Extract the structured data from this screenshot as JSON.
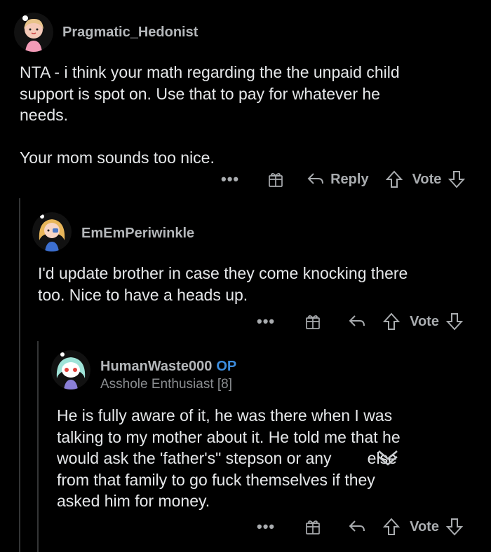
{
  "comments": [
    {
      "username": "Pragmatic_Hedonist",
      "body": "NTA - i think your math regarding the the unpaid child\nsupport is spot on. Use that to pay for whatever he\nneeds.\n\nYour mom sounds too nice.",
      "actions": {
        "more": "•••",
        "reply": "Reply",
        "vote": "Vote"
      }
    },
    {
      "username": "EmEmPeriwinkle",
      "body": "I'd update brother in case they come knocking there\ntoo. Nice to have a heads up.",
      "actions": {
        "more": "•••",
        "vote": "Vote"
      }
    },
    {
      "username": "HumanWaste000",
      "op_label": "OP",
      "flair": "Asshole Enthusiast [8]",
      "body": "He is fully aware of it, he was there when I was\ntalking to my mother about it. He told me that he\nwould ask the 'father's\" stepson or any        else\nfrom that family to go fuck themselves if they\nasked him for money.",
      "actions": {
        "more": "•••",
        "vote": "Vote"
      }
    }
  ],
  "colors": {
    "background": "#000000",
    "op": "#3d8dde",
    "thread_line": "#343536"
  }
}
